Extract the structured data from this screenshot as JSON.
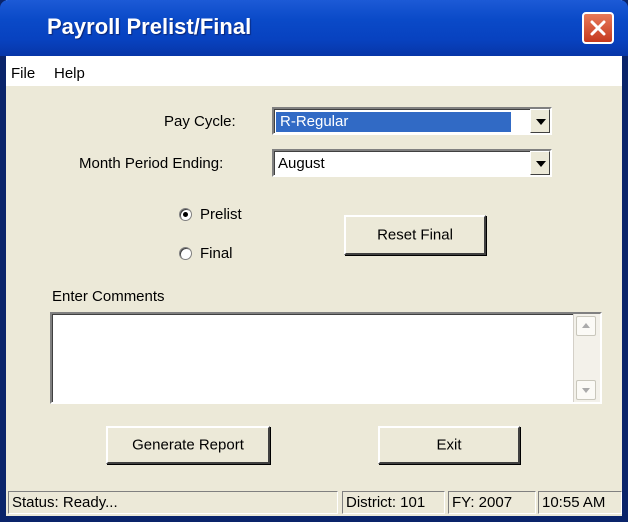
{
  "window": {
    "title": "Payroll Prelist/Final"
  },
  "menu": {
    "file": "File",
    "help": "Help"
  },
  "form": {
    "pay_cycle_label": "Pay Cycle:",
    "pay_cycle_value": "R-Regular",
    "month_label": "Month Period Ending:",
    "month_value": "August",
    "radio_prelist": "Prelist",
    "radio_final": "Final",
    "selected_mode": "Prelist",
    "reset_final_label": "Reset Final",
    "comments_label": "Enter Comments",
    "comments_value": "",
    "generate_label": "Generate Report",
    "exit_label": "Exit"
  },
  "status": {
    "text": "Status: Ready...",
    "district": "District: 101",
    "fy": "FY: 2007",
    "time": "10:55 AM"
  },
  "icons": {
    "close": "close-icon",
    "dropdown": "chevron-down-icon"
  },
  "colors": {
    "titlebar": "#0a4ac8",
    "close": "#c5391e",
    "selection": "#316ac5",
    "face": "#ece9d8"
  }
}
